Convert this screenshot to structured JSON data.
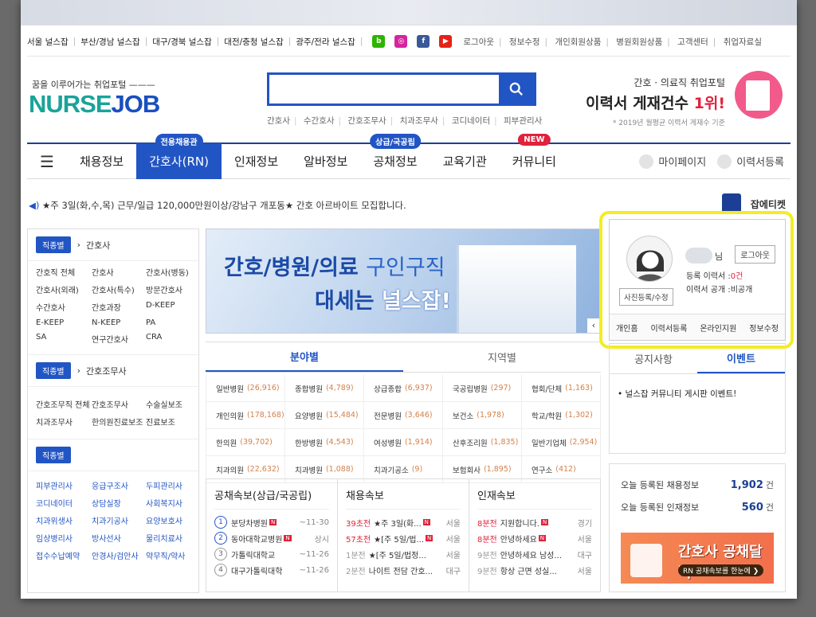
{
  "util_links": [
    "서울 널스잡",
    "부산/경남 널스잡",
    "대구/경북 널스잡",
    "대전/충청 널스잡",
    "광주/전라 널스잡"
  ],
  "util_right": [
    "로그아웃",
    "정보수정",
    "개인회원상품",
    "병원회원상품",
    "고객센터",
    "취업자료실"
  ],
  "brand": {
    "tagline": "꿈을 이루어가는 취업포털 ———",
    "logo_a": "NURSE",
    "logo_b": "JOB"
  },
  "search": {
    "placeholder": ""
  },
  "keywords": [
    "간호사",
    "수간호사",
    "간호조무사",
    "치과조무사",
    "코디네이터",
    "피부관리사"
  ],
  "promo": {
    "line1": "간호 · 의료직 취업포털",
    "line2": "이력서 게재건수",
    "line2_hi": "1위!",
    "line3": "* 2019년 월평균 이력서 게재수 기준"
  },
  "nav": {
    "items": [
      "채용정보",
      "간호사(RN)",
      "인재정보",
      "알바정보",
      "공채정보",
      "교육기관",
      "커뮤니티"
    ],
    "badges": {
      "b1": "전용채용관",
      "b2": "상급/국공립",
      "b3": "NEW"
    },
    "right": [
      "마이페이지",
      "이력서등록"
    ]
  },
  "ticker": "★주 3일(화,수,목) 근무/일급 120,000만원이상/강남구 개포동★ 간호 아르바이트 모집합니다.",
  "jobticket": "잡에티켓",
  "categories": [
    {
      "chip": "직종별",
      "title": "간호사",
      "items": [
        "간호직 전체",
        "간호사",
        "간호사(병동)",
        "간호사(외래)",
        "간호사(특수)",
        "방문간호사",
        "수간호사",
        "간호과장",
        "D-KEEP",
        "E-KEEP",
        "N-KEEP",
        "PA",
        "SA",
        "연구간호사",
        "CRA"
      ]
    },
    {
      "chip": "직종별",
      "title": "간호조무사",
      "items": [
        "간호조무직 전체",
        "간호조무사",
        "수술실보조",
        "치과조무사",
        "한의원진료보조",
        "진료보조"
      ]
    },
    {
      "chip": "직종별",
      "title": "",
      "items": [
        "피부관리사",
        "응급구조사",
        "두피관리사",
        "코디네이터",
        "상담실장",
        "사회복지사",
        "치과위생사",
        "치과기공사",
        "요양보호사",
        "임상병리사",
        "방사선사",
        "물리치료사",
        "접수수납예약",
        "안경사/검안사",
        "약무직/약사"
      ]
    }
  ],
  "banner": {
    "t1a": "간호/병원/의료",
    "t1b": "구인구직",
    "t2a": "대세는",
    "t2b": "널스잡!"
  },
  "tabs": [
    "분야별",
    "지역별"
  ],
  "hospitals": [
    [
      "일반병원",
      "(26,916)"
    ],
    [
      "종합병원",
      "(4,789)"
    ],
    [
      "상급종합",
      "(6,937)"
    ],
    [
      "국공립병원",
      "(297)"
    ],
    [
      "협회/단체",
      "(1,163)"
    ],
    [
      "개인의원",
      "(178,168)"
    ],
    [
      "요양병원",
      "(15,484)"
    ],
    [
      "전문병원",
      "(3,646)"
    ],
    [
      "보건소",
      "(1,978)"
    ],
    [
      "학교/학원",
      "(1,302)"
    ],
    [
      "한의원",
      "(39,702)"
    ],
    [
      "한방병원",
      "(4,543)"
    ],
    [
      "여성병원",
      "(1,914)"
    ],
    [
      "산후조리원",
      "(1,835)"
    ],
    [
      "일반기업체",
      "(2,954)"
    ],
    [
      "치과의원",
      "(22,632)"
    ],
    [
      "치과병원",
      "(1,088)"
    ],
    [
      "치과기공소",
      "(9)"
    ],
    [
      "보험회사",
      "(1,895)"
    ],
    [
      "연구소",
      "(412)"
    ]
  ],
  "col1": {
    "title": "공채속보(상급/국공립)",
    "rows": [
      [
        "1",
        "분당차병원",
        "~11-30"
      ],
      [
        "2",
        "동아대학교병원",
        "상시"
      ],
      [
        "3",
        "가톨릭대학교",
        "~11-26"
      ],
      [
        "4",
        "대구가톨릭대학",
        "~11-26"
      ]
    ]
  },
  "col2": {
    "title": "채용속보",
    "rows": [
      [
        "39초전",
        "★주 3일(화...",
        "서울"
      ],
      [
        "57초전",
        "★[주 5일/법...",
        "서울"
      ],
      [
        "1분전",
        "★[주 5일/법정...",
        "서울"
      ],
      [
        "2분전",
        "나이트 전담 간호...",
        "대구"
      ]
    ]
  },
  "col3": {
    "title": "인재속보",
    "rows": [
      [
        "8분전",
        "지원합니다.",
        "경기"
      ],
      [
        "8분전",
        "안녕하세요",
        "서울"
      ],
      [
        "9분전",
        "안녕하세요 남성...",
        "대구"
      ],
      [
        "9분전",
        "항상 근면 성실...",
        "서울"
      ]
    ]
  },
  "login": {
    "nim": "님",
    "logout": "로그아웃",
    "photo": "사진등록/수정",
    "reg_label": "등록 이력서 :",
    "reg_val": "0건",
    "open_label": "이력서 공개 :",
    "open_val": "비공개",
    "menu": [
      "개인홈",
      "이력서등록",
      "온라인지원",
      "정보수정"
    ]
  },
  "notice_tabs": [
    "공지사항",
    "이벤트"
  ],
  "notice_item": "• 널스잡 커뮤니티 게시판 이벤트!",
  "counts": [
    {
      "label": "오늘 등록된 채용정보",
      "num": "1,902",
      "unit": "건"
    },
    {
      "label": "오늘 등록된 인재정보",
      "num": "560",
      "unit": "건"
    }
  ],
  "calendar": {
    "title": "간호사 공채달력",
    "sub": "RN 공채속보를 한눈에 ❯"
  }
}
